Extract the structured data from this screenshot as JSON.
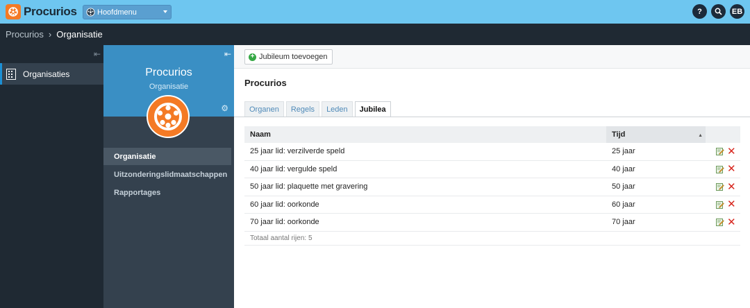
{
  "app": {
    "name": "Procurios"
  },
  "topbar": {
    "menu_label": "Hoofdmenu",
    "help_label": "?",
    "search_label": "",
    "user_initials": "EB"
  },
  "breadcrumb": {
    "root": "Procurios",
    "separator": "›",
    "current": "Organisatie"
  },
  "leftnav": {
    "items": [
      {
        "label": "Organisaties",
        "icon": "building-icon"
      }
    ]
  },
  "panel": {
    "title": "Procurios",
    "subtitle": "Organisatie",
    "menu": [
      {
        "label": "Organisatie",
        "active": true
      },
      {
        "label": "Uitzonderingslidmaatschappen",
        "active": false
      },
      {
        "label": "Rapportages",
        "active": false
      }
    ]
  },
  "main": {
    "add_button": "Jubileum toevoegen",
    "org_title": "Procurios",
    "tabs": [
      {
        "label": "Organen",
        "active": false
      },
      {
        "label": "Regels",
        "active": false
      },
      {
        "label": "Leden",
        "active": false
      },
      {
        "label": "Jubilea",
        "active": true
      }
    ],
    "table": {
      "columns": {
        "naam": "Naam",
        "tijd": "Tijd"
      },
      "rows": [
        {
          "naam": "25 jaar lid: verzilverde speld",
          "tijd": "25 jaar"
        },
        {
          "naam": "40 jaar lid: vergulde speld",
          "tijd": "40 jaar"
        },
        {
          "naam": "50 jaar lid: plaquette met gravering",
          "tijd": "50 jaar"
        },
        {
          "naam": "60 jaar lid: oorkonde",
          "tijd": "60 jaar"
        },
        {
          "naam": "70 jaar lid: oorkonde",
          "tijd": "70 jaar"
        }
      ],
      "footer": "Totaal aantal rijen: 5"
    }
  },
  "colors": {
    "brand_orange": "#f47a25",
    "topbar": "#6ec6f0",
    "accent_blue": "#3a8fc4",
    "delete_red": "#d7261e"
  }
}
